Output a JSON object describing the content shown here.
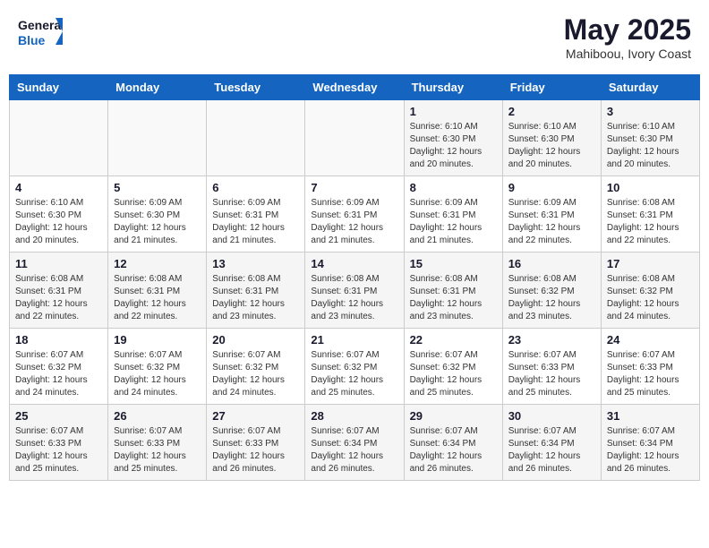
{
  "header": {
    "logo_line1": "General",
    "logo_line2": "Blue",
    "month": "May 2025",
    "location": "Mahiboou, Ivory Coast"
  },
  "weekdays": [
    "Sunday",
    "Monday",
    "Tuesday",
    "Wednesday",
    "Thursday",
    "Friday",
    "Saturday"
  ],
  "weeks": [
    [
      {
        "day": "",
        "info": ""
      },
      {
        "day": "",
        "info": ""
      },
      {
        "day": "",
        "info": ""
      },
      {
        "day": "",
        "info": ""
      },
      {
        "day": "1",
        "info": "Sunrise: 6:10 AM\nSunset: 6:30 PM\nDaylight: 12 hours\nand 20 minutes."
      },
      {
        "day": "2",
        "info": "Sunrise: 6:10 AM\nSunset: 6:30 PM\nDaylight: 12 hours\nand 20 minutes."
      },
      {
        "day": "3",
        "info": "Sunrise: 6:10 AM\nSunset: 6:30 PM\nDaylight: 12 hours\nand 20 minutes."
      }
    ],
    [
      {
        "day": "4",
        "info": "Sunrise: 6:10 AM\nSunset: 6:30 PM\nDaylight: 12 hours\nand 20 minutes."
      },
      {
        "day": "5",
        "info": "Sunrise: 6:09 AM\nSunset: 6:30 PM\nDaylight: 12 hours\nand 21 minutes."
      },
      {
        "day": "6",
        "info": "Sunrise: 6:09 AM\nSunset: 6:31 PM\nDaylight: 12 hours\nand 21 minutes."
      },
      {
        "day": "7",
        "info": "Sunrise: 6:09 AM\nSunset: 6:31 PM\nDaylight: 12 hours\nand 21 minutes."
      },
      {
        "day": "8",
        "info": "Sunrise: 6:09 AM\nSunset: 6:31 PM\nDaylight: 12 hours\nand 21 minutes."
      },
      {
        "day": "9",
        "info": "Sunrise: 6:09 AM\nSunset: 6:31 PM\nDaylight: 12 hours\nand 22 minutes."
      },
      {
        "day": "10",
        "info": "Sunrise: 6:08 AM\nSunset: 6:31 PM\nDaylight: 12 hours\nand 22 minutes."
      }
    ],
    [
      {
        "day": "11",
        "info": "Sunrise: 6:08 AM\nSunset: 6:31 PM\nDaylight: 12 hours\nand 22 minutes."
      },
      {
        "day": "12",
        "info": "Sunrise: 6:08 AM\nSunset: 6:31 PM\nDaylight: 12 hours\nand 22 minutes."
      },
      {
        "day": "13",
        "info": "Sunrise: 6:08 AM\nSunset: 6:31 PM\nDaylight: 12 hours\nand 23 minutes."
      },
      {
        "day": "14",
        "info": "Sunrise: 6:08 AM\nSunset: 6:31 PM\nDaylight: 12 hours\nand 23 minutes."
      },
      {
        "day": "15",
        "info": "Sunrise: 6:08 AM\nSunset: 6:31 PM\nDaylight: 12 hours\nand 23 minutes."
      },
      {
        "day": "16",
        "info": "Sunrise: 6:08 AM\nSunset: 6:32 PM\nDaylight: 12 hours\nand 23 minutes."
      },
      {
        "day": "17",
        "info": "Sunrise: 6:08 AM\nSunset: 6:32 PM\nDaylight: 12 hours\nand 24 minutes."
      }
    ],
    [
      {
        "day": "18",
        "info": "Sunrise: 6:07 AM\nSunset: 6:32 PM\nDaylight: 12 hours\nand 24 minutes."
      },
      {
        "day": "19",
        "info": "Sunrise: 6:07 AM\nSunset: 6:32 PM\nDaylight: 12 hours\nand 24 minutes."
      },
      {
        "day": "20",
        "info": "Sunrise: 6:07 AM\nSunset: 6:32 PM\nDaylight: 12 hours\nand 24 minutes."
      },
      {
        "day": "21",
        "info": "Sunrise: 6:07 AM\nSunset: 6:32 PM\nDaylight: 12 hours\nand 25 minutes."
      },
      {
        "day": "22",
        "info": "Sunrise: 6:07 AM\nSunset: 6:32 PM\nDaylight: 12 hours\nand 25 minutes."
      },
      {
        "day": "23",
        "info": "Sunrise: 6:07 AM\nSunset: 6:33 PM\nDaylight: 12 hours\nand 25 minutes."
      },
      {
        "day": "24",
        "info": "Sunrise: 6:07 AM\nSunset: 6:33 PM\nDaylight: 12 hours\nand 25 minutes."
      }
    ],
    [
      {
        "day": "25",
        "info": "Sunrise: 6:07 AM\nSunset: 6:33 PM\nDaylight: 12 hours\nand 25 minutes."
      },
      {
        "day": "26",
        "info": "Sunrise: 6:07 AM\nSunset: 6:33 PM\nDaylight: 12 hours\nand 25 minutes."
      },
      {
        "day": "27",
        "info": "Sunrise: 6:07 AM\nSunset: 6:33 PM\nDaylight: 12 hours\nand 26 minutes."
      },
      {
        "day": "28",
        "info": "Sunrise: 6:07 AM\nSunset: 6:34 PM\nDaylight: 12 hours\nand 26 minutes."
      },
      {
        "day": "29",
        "info": "Sunrise: 6:07 AM\nSunset: 6:34 PM\nDaylight: 12 hours\nand 26 minutes."
      },
      {
        "day": "30",
        "info": "Sunrise: 6:07 AM\nSunset: 6:34 PM\nDaylight: 12 hours\nand 26 minutes."
      },
      {
        "day": "31",
        "info": "Sunrise: 6:07 AM\nSunset: 6:34 PM\nDaylight: 12 hours\nand 26 minutes."
      }
    ]
  ]
}
